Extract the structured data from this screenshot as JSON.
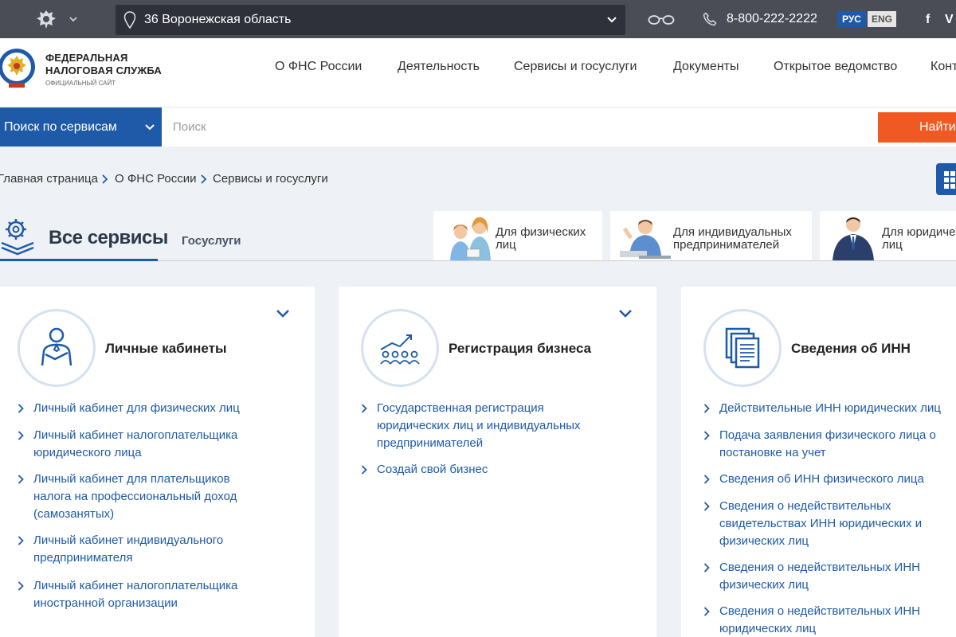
{
  "topbar": {
    "region": "36 Воронежская область",
    "phone": "8-800-222-2222",
    "lang_ru": "РУС",
    "lang_en": "ENG",
    "social_fb": "f",
    "social_vk": "V"
  },
  "logo": {
    "line1": "ФЕДЕРАЛЬНАЯ",
    "line2": "НАЛОГОВАЯ СЛУЖБА",
    "line3": "ОФИЦИАЛЬНЫЙ САЙТ"
  },
  "nav": [
    "О ФНС России",
    "Деятельность",
    "Сервисы и госуслуги",
    "Документы",
    "Открытое ведомство",
    "Конт"
  ],
  "search": {
    "scope": "Поиск по сервисам",
    "placeholder": "Поиск",
    "button": "Найти"
  },
  "breadcrumb": [
    "Главная страница",
    "О ФНС России",
    "Сервисы и госуслуги"
  ],
  "tabs": {
    "all": "Все сервисы",
    "gos": "Госуслуги"
  },
  "audiences": [
    {
      "line1": "Для физических",
      "line2": "лиц"
    },
    {
      "line1": "Для индивидуальных",
      "line2": "предпринимателей"
    },
    {
      "line1": "Для юридиче",
      "line2": "лиц"
    }
  ],
  "cards": [
    {
      "title": "Личные кабинеты",
      "icon": "person-icon",
      "links": [
        [
          "Личный кабинет для физических лиц"
        ],
        [
          "Личный кабинет налогоплательщика",
          "юридического лица"
        ],
        [
          "Личный кабинет для плательщиков",
          "налога на профессиональный доход",
          "(самозанятых)"
        ],
        [
          "Личный кабинет индивидуального",
          "предпринимателя"
        ],
        [
          "Личный кабинет налогоплательщика",
          "иностранной организации"
        ]
      ]
    },
    {
      "title": "Регистрация бизнеса",
      "icon": "business-growth-icon",
      "links": [
        [
          "Государственная регистрация",
          "юридических лиц и индивидуальных",
          "предпринимателей"
        ],
        [
          "Создай свой бизнес"
        ]
      ]
    },
    {
      "title": "Сведения об ИНН",
      "icon": "documents-icon",
      "links": [
        [
          "Действительные ИНН юридических лиц"
        ],
        [
          "Подача заявления физического лица о",
          "постановке на учет"
        ],
        [
          "Сведения об ИНН физического лица"
        ],
        [
          "Сведения о недействительных",
          "свидетельствах ИНН юридических и",
          "физических лиц"
        ],
        [
          "Сведения о недействительных ИНН",
          "физических лиц"
        ],
        [
          "Сведения о недействительных ИНН",
          "юридических лиц"
        ]
      ]
    }
  ],
  "colors": {
    "topbar": "#4a4d55",
    "accent": "#1e5aa8",
    "search_button": "#f05a22",
    "background": "#eef1f6"
  }
}
